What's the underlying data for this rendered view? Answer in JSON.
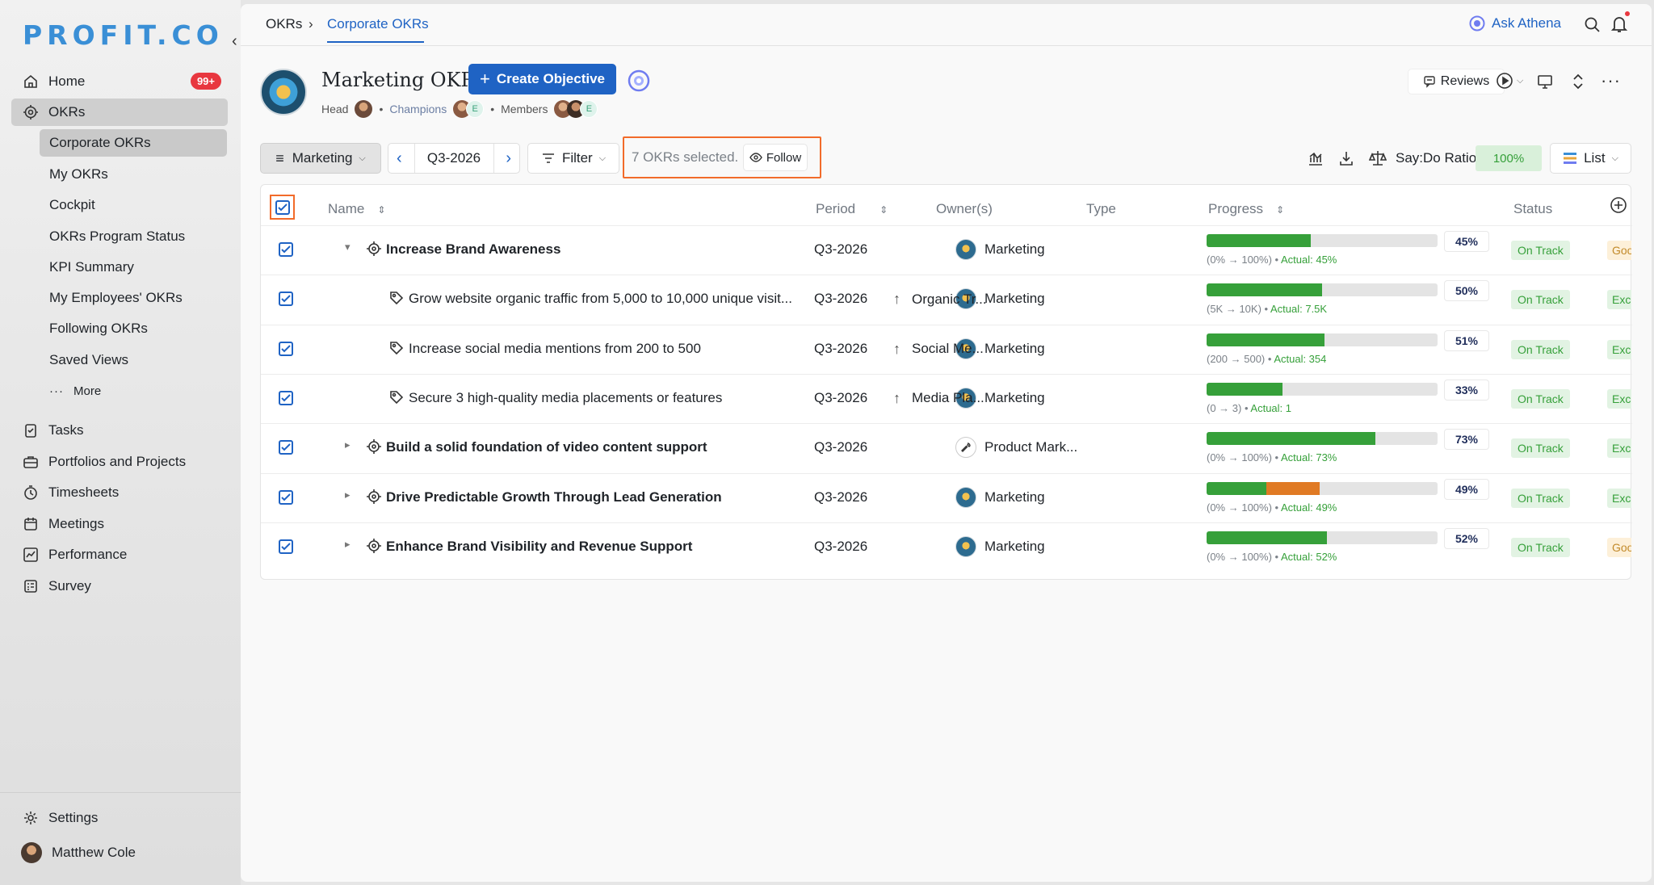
{
  "app": {
    "logo": "PROFIT.CO"
  },
  "sidebar": {
    "items": [
      {
        "label": "Home",
        "badge": "99+"
      },
      {
        "label": "OKRs"
      },
      {
        "label": "Tasks"
      },
      {
        "label": "Portfolios and Projects"
      },
      {
        "label": "Timesheets"
      },
      {
        "label": "Meetings"
      },
      {
        "label": "Performance"
      },
      {
        "label": "Survey"
      }
    ],
    "okr_sub": [
      "Corporate OKRs",
      "My OKRs",
      "Cockpit",
      "OKRs Program Status",
      "KPI Summary",
      "My Employees' OKRs",
      "Following OKRs",
      "Saved Views",
      "More"
    ],
    "settings": "Settings",
    "user": "Matthew Cole"
  },
  "topbar": {
    "crumbs": [
      "OKRs",
      "Corporate OKRs"
    ],
    "ask": "Ask Athena"
  },
  "header": {
    "title": "Marketing OKRs",
    "create_btn": "Create Objective",
    "head_label": "Head",
    "champions_label": "Champions",
    "members_label": "Members",
    "avatar_letter": "E",
    "reviews": "Reviews"
  },
  "toolbar": {
    "team": "Marketing",
    "period": "Q3-2026",
    "filter": "Filter",
    "selected": "7 OKRs selected.",
    "follow": "Follow",
    "saydo_label": "Say:Do Ratio",
    "saydo_value": "100%",
    "view": "List"
  },
  "table": {
    "headers": {
      "name": "Name",
      "period": "Period",
      "owners": "Owner(s)",
      "type": "Type",
      "progress": "Progress",
      "status": "Status"
    },
    "rows": [
      {
        "name": "Increase Brand Awareness",
        "period": "Q3-2026",
        "owner": "Marketing",
        "type": "",
        "range": "(0% → 100%)",
        "actual": "Actual: 45%",
        "pct": "45%",
        "progress": 45,
        "progress2": 0,
        "status": "On Track",
        "extra": "Goo",
        "level": 0,
        "expanded": true
      },
      {
        "name": "Grow website organic traffic from 5,000 to 10,000 unique visit...",
        "period": "Q3-2026",
        "owner": "Marketing",
        "type": "Organic Tr...",
        "range": "(5K → 10K)",
        "actual": "Actual: 7.5K",
        "pct": "50%",
        "progress": 50,
        "progress2": 0,
        "status": "On Track",
        "extra": "Exc",
        "level": 1
      },
      {
        "name": "Increase social media mentions from 200 to 500",
        "period": "Q3-2026",
        "owner": "Marketing",
        "type": "Social Me...",
        "range": "(200 → 500)",
        "actual": "Actual: 354",
        "pct": "51%",
        "progress": 51,
        "progress2": 0,
        "status": "On Track",
        "extra": "Exc",
        "level": 1
      },
      {
        "name": "Secure 3 high-quality media placements or features",
        "period": "Q3-2026",
        "owner": "Marketing",
        "type": "Media Pla...",
        "range": "(0 → 3)",
        "actual": "Actual: 1",
        "pct": "33%",
        "progress": 33,
        "progress2": 0,
        "status": "On Track",
        "extra": "Exc",
        "level": 1
      },
      {
        "name": "Build a solid foundation of video content support",
        "period": "Q3-2026",
        "owner": "Product Mark...",
        "type": "",
        "range": "(0% → 100%)",
        "actual": "Actual: 73%",
        "pct": "73%",
        "progress": 73,
        "progress2": 0,
        "status": "On Track",
        "extra": "Exc",
        "level": 0,
        "expanded": false
      },
      {
        "name": "Drive Predictable Growth Through Lead Generation",
        "period": "Q3-2026",
        "owner": "Marketing",
        "type": "",
        "range": "(0% → 100%)",
        "actual": "Actual: 49%",
        "pct": "49%",
        "progress": 26,
        "progress2": 23,
        "status": "On Track",
        "extra": "Exc",
        "level": 0,
        "expanded": false
      },
      {
        "name": "Enhance Brand Visibility and Revenue Support",
        "period": "Q3-2026",
        "owner": "Marketing",
        "type": "",
        "range": "(0% → 100%)",
        "actual": "Actual: 52%",
        "pct": "52%",
        "progress": 52,
        "progress2": 0,
        "status": "On Track",
        "extra": "Goo",
        "level": 0,
        "expanded": false
      }
    ]
  },
  "colors": {
    "accent": "#1f63c4",
    "ontrack": "#36a03a",
    "behind": "#e07a24",
    "highlight": "#f26b2a"
  }
}
